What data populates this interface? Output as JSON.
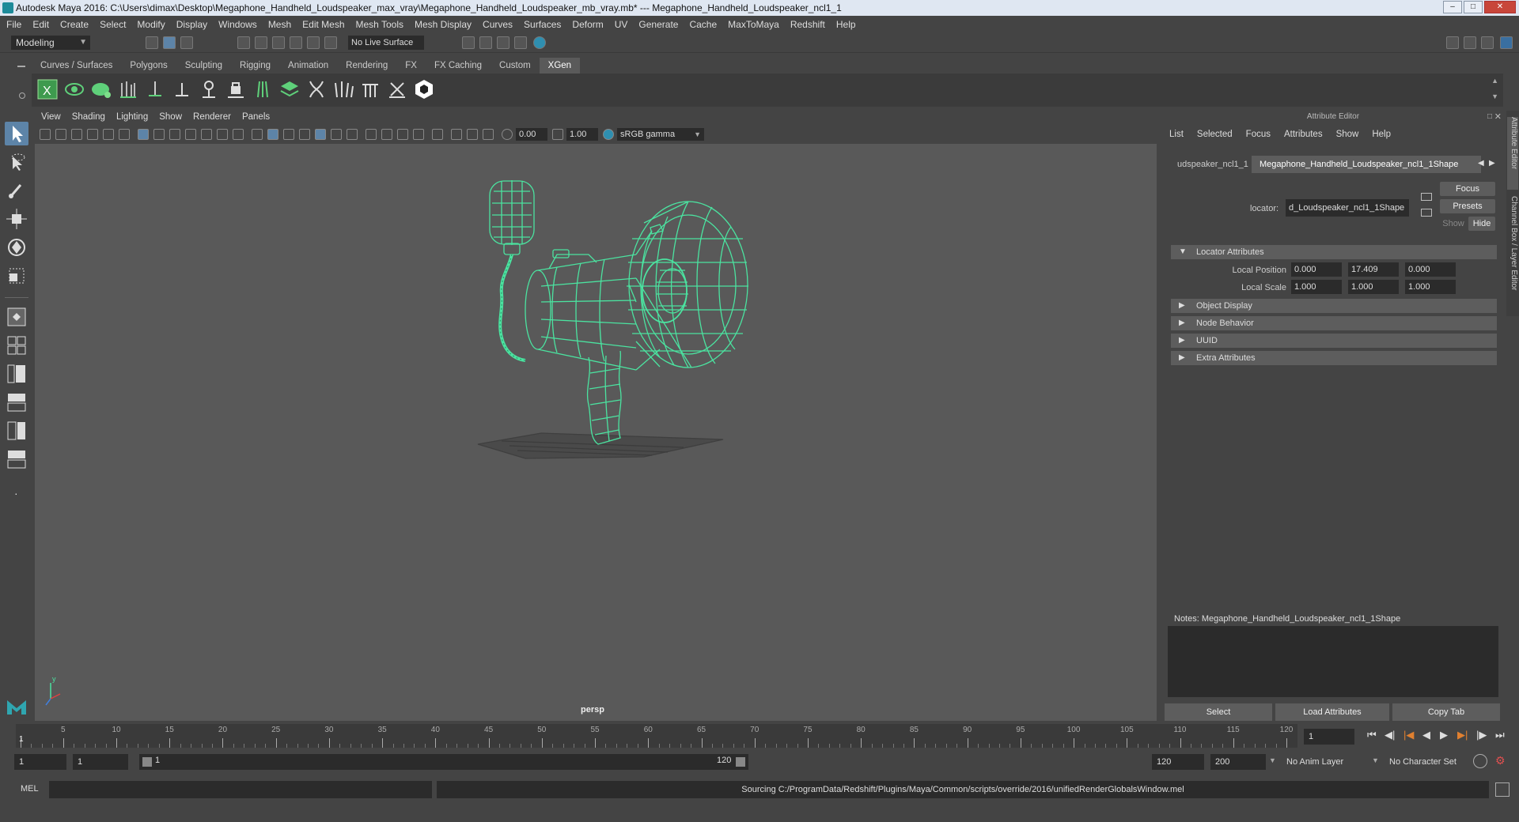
{
  "window": {
    "title": "Autodesk Maya 2016: C:\\Users\\dimax\\Desktop\\Megaphone_Handheld_Loudspeaker_max_vray\\Megaphone_Handheld_Loudspeaker_mb_vray.mb*   ---   Megaphone_Handheld_Loudspeaker_ncl1_1"
  },
  "menubar": [
    "File",
    "Edit",
    "Create",
    "Select",
    "Modify",
    "Display",
    "Windows",
    "Mesh",
    "Edit Mesh",
    "Mesh Tools",
    "Mesh Display",
    "Curves",
    "Surfaces",
    "Deform",
    "UV",
    "Generate",
    "Cache",
    "MaxToMaya",
    "Redshift",
    "Help"
  ],
  "statusline": {
    "mode": "Modeling",
    "live_surface": "No Live Surface"
  },
  "shelf": {
    "tabs": [
      "Curves / Surfaces",
      "Polygons",
      "Sculpting",
      "Rigging",
      "Animation",
      "Rendering",
      "FX",
      "FX Caching",
      "Custom",
      "XGen"
    ],
    "active_tab": "XGen",
    "icons": [
      "xgen-editor-icon",
      "xgen-preview-icon",
      "xgen-description-icon",
      "place-guides-icon",
      "add-guide-icon",
      "guide-length-icon",
      "guide-rotate-icon",
      "lock-length-icon",
      "guide-sculpt-icon",
      "layers-icon",
      "brush-icon",
      "grass-icon",
      "comb-icon",
      "cut-icon",
      "bake-icon",
      "hex-icon"
    ]
  },
  "viewport": {
    "menu": [
      "View",
      "Shading",
      "Lighting",
      "Show",
      "Renderer",
      "Panels"
    ],
    "exposure": "0.00",
    "gamma": "1.00",
    "color_space": "sRGB gamma",
    "camera": "persp"
  },
  "attribute_editor": {
    "title": "Attribute Editor",
    "menu": [
      "List",
      "Selected",
      "Focus",
      "Attributes",
      "Show",
      "Help"
    ],
    "tabs": [
      "udspeaker_ncl1_1",
      "Megaphone_Handheld_Loudspeaker_ncl1_1Shape"
    ],
    "locator_label": "locator:",
    "locator_value": "d_Loudspeaker_ncl1_1Shape",
    "buttons": {
      "focus": "Focus",
      "presets": "Presets",
      "show": "Show",
      "hide": "Hide"
    },
    "sections": {
      "locator_attributes": "Locator Attributes",
      "object_display": "Object Display",
      "node_behavior": "Node Behavior",
      "uuid": "UUID",
      "extra_attributes": "Extra Attributes"
    },
    "local_position": {
      "label": "Local Position",
      "x": "0.000",
      "y": "17.409",
      "z": "0.000"
    },
    "local_scale": {
      "label": "Local Scale",
      "x": "1.000",
      "y": "1.000",
      "z": "1.000"
    },
    "notes": "Notes:  Megaphone_Handheld_Loudspeaker_ncl1_1Shape",
    "bottom_buttons": {
      "select": "Select",
      "load": "Load Attributes",
      "copy": "Copy Tab"
    }
  },
  "side_tabs": [
    "Attribute Editor",
    "Channel Box / Layer Editor"
  ],
  "timeline": {
    "ticks": [
      1,
      5,
      10,
      15,
      20,
      25,
      30,
      35,
      40,
      45,
      50,
      55,
      60,
      65,
      70,
      75,
      80,
      85,
      90,
      95,
      100,
      105,
      110,
      115,
      120
    ],
    "current_frame": "1",
    "current_frame_label": "1"
  },
  "range": {
    "start": "1",
    "start_inner": "1",
    "slider_start": "1",
    "slider_end": "120",
    "end_inner": "120",
    "end": "200",
    "anim_layer": "No Anim Layer",
    "character_set": "No Character Set"
  },
  "command": {
    "type": "MEL",
    "output": "Sourcing C:/ProgramData/Redshift/Plugins/Maya/Common/scripts/override/2016/unifiedRenderGlobalsWindow.mel"
  },
  "colors": {
    "wireframe": "#4be3a0",
    "viewport_bg": "#595959",
    "ui_bg": "#444444",
    "selected_tool": "#5d84a8"
  }
}
